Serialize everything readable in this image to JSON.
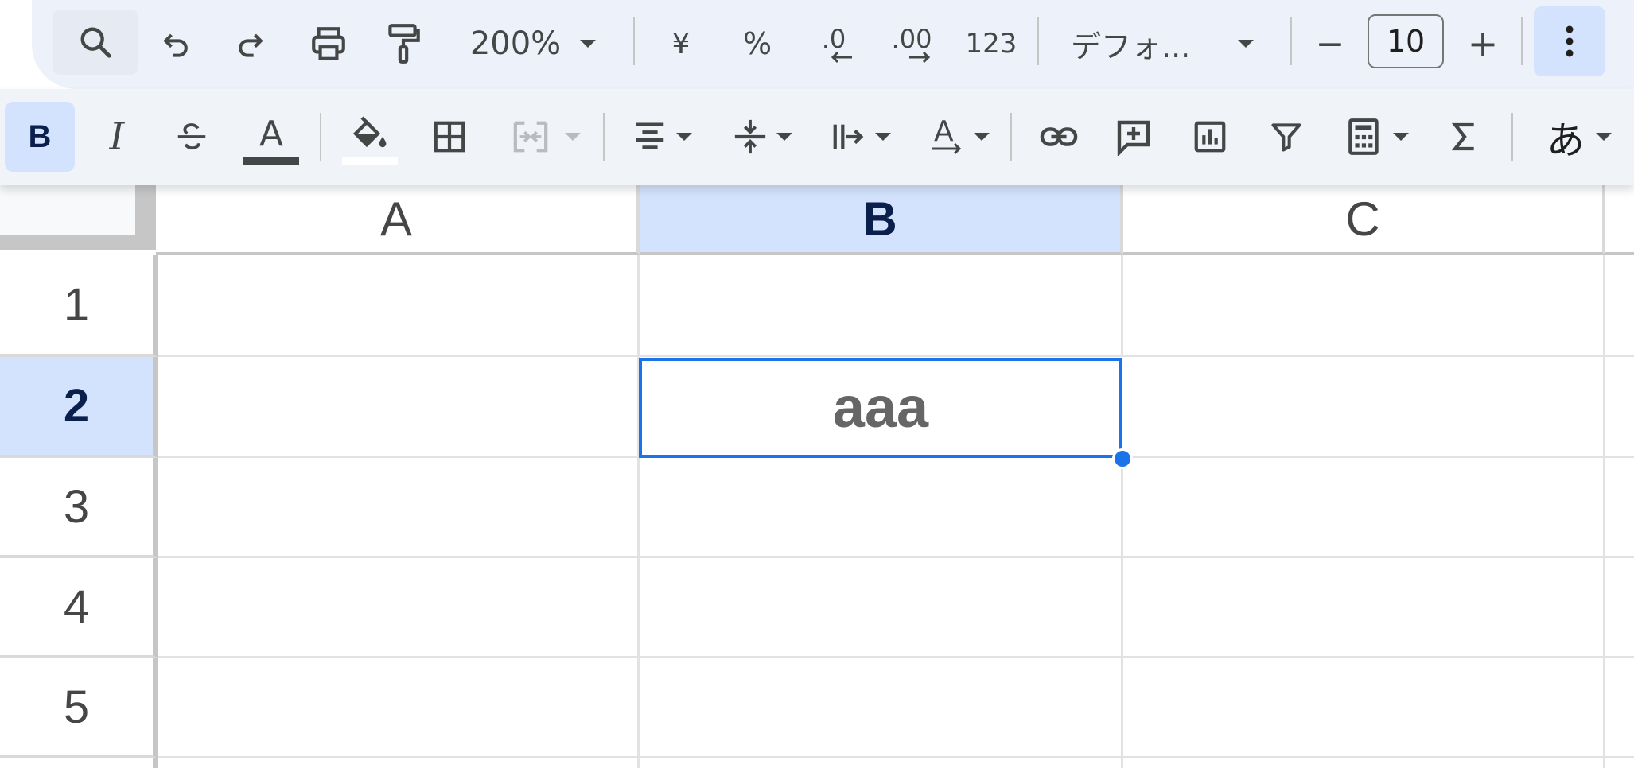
{
  "toolbar": {
    "zoom": "200%",
    "currency": "¥",
    "percent": "%",
    "decrease_decimal": ".0",
    "increase_decimal": ".00",
    "number_format": "123",
    "font": "デフォ...",
    "font_size_minus": "−",
    "font_size": "10",
    "font_size_plus": "+",
    "bold": "B",
    "italic": "I",
    "text_color_letter": "A",
    "text_rotation_letter": "A",
    "input_tools": "あ"
  },
  "grid": {
    "columns": [
      "A",
      "B",
      "C"
    ],
    "selected_column": "B",
    "rows": [
      "1",
      "2",
      "3",
      "4",
      "5"
    ],
    "selected_row": "2",
    "active_cell_value": "aaa"
  },
  "colors": {
    "accent": "#1a73e8",
    "selection_header": "#d3e3fd",
    "toolbar_bg": "#edf2fa"
  }
}
